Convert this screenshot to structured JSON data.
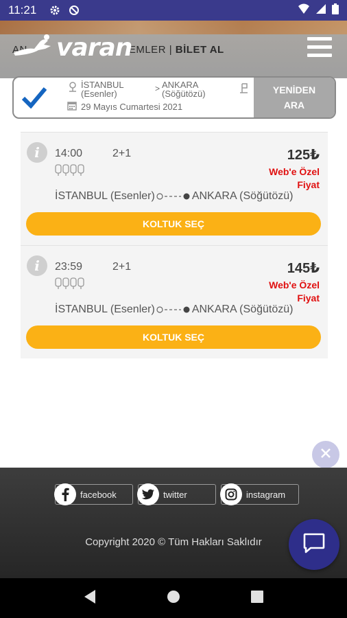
{
  "status_bar": {
    "time": "11:21"
  },
  "header": {
    "logo_text": "varan",
    "nav_left": "AN",
    "nav_mid": "EMLER",
    "nav_sep": "|",
    "nav_bold": "BİLET AL"
  },
  "search": {
    "from_city": "İSTANBUL",
    "from_station": "(Esenler)",
    "arrow": ">",
    "to_city": "ANKARA",
    "to_station": "(Söğütözü)",
    "date": "29 Mayıs Cumartesi 2021",
    "again_line1": "YENİDEN",
    "again_line2": "ARA"
  },
  "trips": [
    {
      "time": "14:00",
      "layout": "2+1",
      "price": "125₺",
      "web_line1": "Web'e Özel",
      "web_line2": "Fiyat",
      "from": "İSTANBUL (Esenler)",
      "to": "ANKARA (Söğütözü)",
      "button": "KOLTUK SEÇ"
    },
    {
      "time": "23:59",
      "layout": "2+1",
      "price": "145₺",
      "web_line1": "Web'e Özel",
      "web_line2": "Fiyat",
      "from": "İSTANBUL (Esenler)",
      "to": "ANKARA (Söğütözü)",
      "button": "KOLTUK SEÇ"
    }
  ],
  "footer": {
    "facebook": "facebook",
    "twitter": "twitter",
    "instagram": "instagram",
    "copyright": "Copyright 2020 © Tüm Hakları Saklıdır"
  },
  "colors": {
    "accent": "#fbb115",
    "price_red": "#e01010",
    "status_bar": "#3a3a8c",
    "chat_fab": "#2e2e8a"
  }
}
